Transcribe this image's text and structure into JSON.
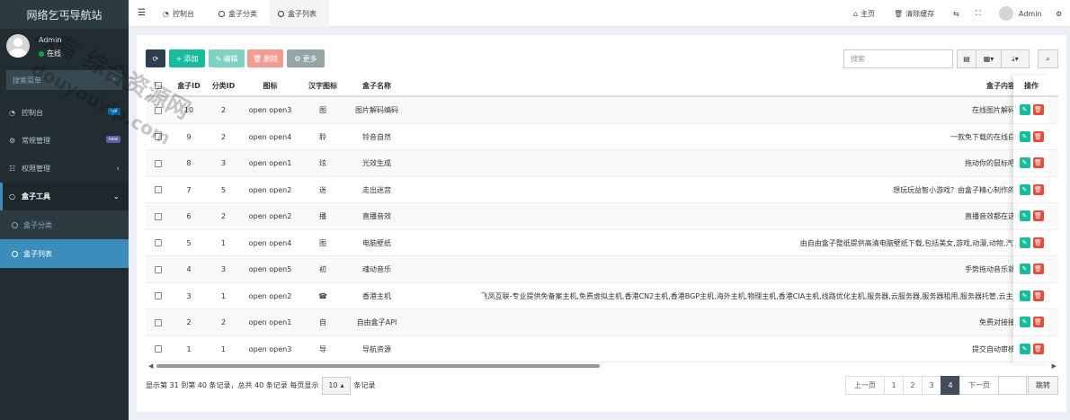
{
  "app": {
    "title": "网络乞丐导航站"
  },
  "user": {
    "name": "Admin",
    "status": "在线"
  },
  "sidebar_search": {
    "placeholder": "搜索菜单"
  },
  "menu": [
    {
      "label": "控制台",
      "icon": "dashboard-icon",
      "badge": "hot",
      "badge_color": "#0073b7"
    },
    {
      "label": "常规管理",
      "icon": "cogs-icon",
      "badge": "new",
      "badge_color": "#605ca8"
    },
    {
      "label": "权限管理",
      "icon": "group-icon",
      "arrow": "‹"
    },
    {
      "label": "盒子工具",
      "icon": "circle-icon",
      "arrow": "⌄"
    }
  ],
  "submenu": [
    {
      "label": "盒子分类",
      "active": false
    },
    {
      "label": "盒子列表",
      "active": true
    }
  ],
  "header": {
    "tabs": [
      "控制台",
      "盒子分类",
      "盒子列表"
    ],
    "home": "主页",
    "clear_cache": "清除缓存",
    "user": "Admin"
  },
  "toolbar": {
    "add": "添加",
    "edit": "编辑",
    "delete": "删除",
    "more": "更多",
    "search_placeholder": "搜索"
  },
  "table": {
    "columns": [
      "盒子ID",
      "分类ID",
      "图标",
      "汉字图标",
      "盒子名称",
      "盒子内容",
      "操作"
    ],
    "rows": [
      {
        "id": "10",
        "cat": "2",
        "icon": "open open3",
        "char": "图",
        "name": "图片解码编码",
        "content": "在线图片解码编"
      },
      {
        "id": "9",
        "cat": "2",
        "icon": "open open4",
        "char": "聆",
        "name": "铃音自然",
        "content": "一款免下载的在线白噪"
      },
      {
        "id": "8",
        "cat": "3",
        "icon": "open open1",
        "char": "炫",
        "name": "光效生成",
        "content": "拖动你的鼠标吧！"
      },
      {
        "id": "7",
        "cat": "5",
        "icon": "open open2",
        "char": "迷",
        "name": "走出迷宫",
        "content": "想玩玩益智小游戏？由盒子精心制作的小"
      },
      {
        "id": "6",
        "cat": "2",
        "icon": "open open2",
        "char": "播",
        "name": "直播音效",
        "content": "直播音效都在这里"
      },
      {
        "id": "5",
        "cat": "1",
        "icon": "open open4",
        "char": "图",
        "name": "电脑壁纸",
        "content": "由自由盒子整纸提供高清电脑壁纸下载,包括美女,游戏,动漫,动物,汽车,"
      },
      {
        "id": "4",
        "cat": "3",
        "icon": "open open5",
        "char": "初",
        "name": "魂动音乐",
        "content": "手势拖动音乐就会"
      },
      {
        "id": "3",
        "cat": "1",
        "icon": "open open2",
        "char": "☎",
        "name": "香港主机",
        "content": "飞凤互联-专业提供免备案主机,免费虚拟主机,香港CN2主机,香港BGP主机,海外主机,物理主机,香港CIA主机,线路优化主机,服务器,云服务器,服务器租用,服务器托管,云主机,"
      },
      {
        "id": "2",
        "cat": "2",
        "icon": "open open1",
        "char": "自",
        "name": "自由盒子API",
        "content": "免费对接接口"
      },
      {
        "id": "1",
        "cat": "1",
        "icon": "open open3",
        "char": "导",
        "name": "导航资源",
        "content": "提交自动审核添"
      }
    ]
  },
  "pagination": {
    "info_prefix": "显示第 31 到第 40 条记录，总共 40 条记录 每页显示",
    "page_size": "10",
    "info_suffix": "条记录",
    "prev": "上一页",
    "pages": [
      "1",
      "2",
      "3",
      "4"
    ],
    "current": "4",
    "next": "下一页",
    "jump": "跳转"
  },
  "watermark": {
    "lines": [
      "源有 综合资源网",
      "douyouvip.com"
    ]
  },
  "colors": {
    "sidebar": "#222d32",
    "accent": "#3c8dbc",
    "add": "#18bc9c",
    "edit": "#7fd2c1",
    "delete": "#f39c93",
    "more": "#95a5a6",
    "refresh": "#2c3e50"
  }
}
